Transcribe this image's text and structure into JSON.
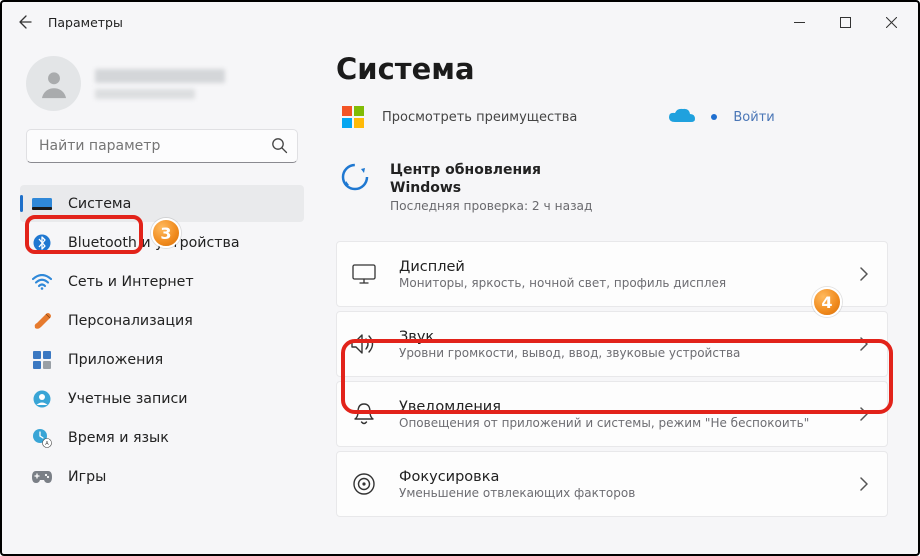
{
  "titlebar": {
    "title": "Параметры"
  },
  "search": {
    "placeholder": "Найти параметр"
  },
  "nav": {
    "items": [
      {
        "label": "Система"
      },
      {
        "label": "Bluetooth и устройства"
      },
      {
        "label": "Сеть и Интернет"
      },
      {
        "label": "Персонализация"
      },
      {
        "label": "Приложения"
      },
      {
        "label": "Учетные записи"
      },
      {
        "label": "Время и язык"
      },
      {
        "label": "Игры"
      }
    ]
  },
  "main": {
    "title": "Система",
    "promo": {
      "text": "Просмотреть преимущества",
      "login": "Войти"
    },
    "update": {
      "title1": "Центр обновления",
      "title2": "Windows",
      "sub": "Последняя проверка: 2 ч назад"
    },
    "cards": [
      {
        "title": "Дисплей",
        "sub": "Мониторы, яркость, ночной свет, профиль дисплея"
      },
      {
        "title": "Звук",
        "sub": "Уровни громкости, вывод, ввод, звуковые устройства"
      },
      {
        "title": "Уведомления",
        "sub": "Оповещения от приложений и системы, режим \"Не беспокоить\""
      },
      {
        "title": "Фокусировка",
        "sub": "Уменьшение отвлекающих факторов"
      }
    ]
  },
  "badges": {
    "b3": "3",
    "b4": "4"
  }
}
